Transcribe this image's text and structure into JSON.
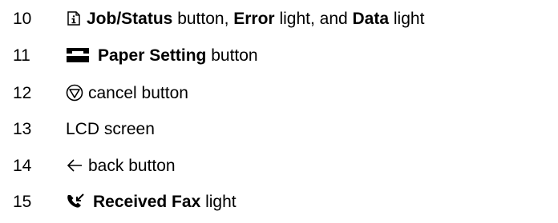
{
  "items": [
    {
      "number": "10",
      "icon": "job-status-icon",
      "parts": [
        {
          "text": "Job/Status",
          "bold": true
        },
        {
          "text": " button, ",
          "bold": false
        },
        {
          "text": "Error",
          "bold": true
        },
        {
          "text": " light, and ",
          "bold": false
        },
        {
          "text": "Data",
          "bold": true
        },
        {
          "text": " light",
          "bold": false
        }
      ]
    },
    {
      "number": "11",
      "icon": "paper-setting-icon",
      "parts": [
        {
          "text": "Paper Setting",
          "bold": true
        },
        {
          "text": " button",
          "bold": false
        }
      ]
    },
    {
      "number": "12",
      "icon": "cancel-stop-icon",
      "parts": [
        {
          "text": "cancel button",
          "bold": false
        }
      ]
    },
    {
      "number": "13",
      "icon": "",
      "parts": [
        {
          "text": "LCD screen",
          "bold": false
        }
      ]
    },
    {
      "number": "14",
      "icon": "back-arrow-icon",
      "parts": [
        {
          "text": "back button",
          "bold": false
        }
      ]
    },
    {
      "number": "15",
      "icon": "received-fax-icon",
      "parts": [
        {
          "text": "Received Fax",
          "bold": true
        },
        {
          "text": " light",
          "bold": false
        }
      ]
    }
  ]
}
